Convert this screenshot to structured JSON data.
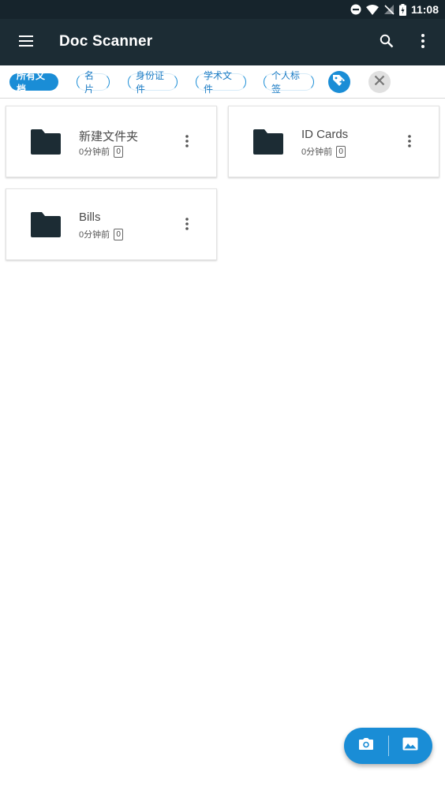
{
  "status_bar": {
    "time": "11:08"
  },
  "app_bar": {
    "title": "Doc Scanner"
  },
  "tags": [
    {
      "label": "所有文档",
      "active": true
    },
    {
      "label": "名片",
      "active": false
    },
    {
      "label": "身份证件",
      "active": false
    },
    {
      "label": "学术文件",
      "active": false
    },
    {
      "label": "个人标签",
      "active": false
    }
  ],
  "folders": [
    {
      "name": "新建文件夹",
      "time": "0分钟前",
      "count": "0"
    },
    {
      "name": "ID Cards",
      "time": "0分钟前",
      "count": "0"
    },
    {
      "name": "Bills",
      "time": "0分钟前",
      "count": "0"
    }
  ],
  "colors": {
    "status_bar": "#16242c",
    "app_bar": "#1c2c34",
    "accent": "#1a8dd6",
    "folder_icon": "#1c2c34"
  },
  "icons": {
    "menu": "menu-icon",
    "search": "search-icon",
    "overflow": "more-vertical-icon",
    "folder": "folder-icon",
    "add_tag": "add-tag-icon",
    "clear": "close-icon",
    "camera": "camera-icon",
    "gallery": "image-icon"
  }
}
